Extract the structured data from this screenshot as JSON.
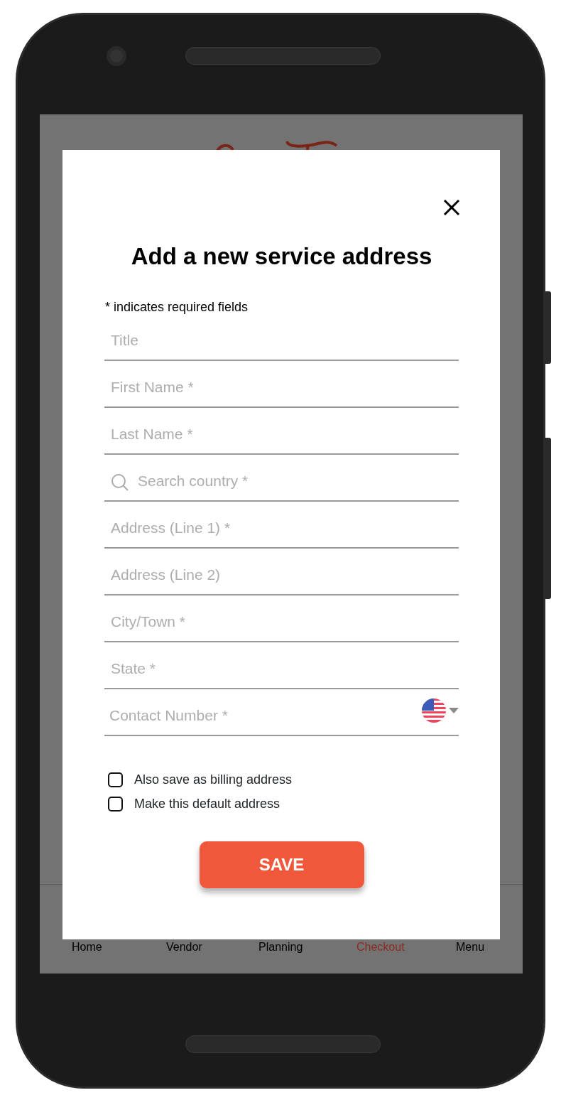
{
  "background_page": {
    "nav": [
      {
        "label": "Home",
        "selected": false
      },
      {
        "label": "Vendor",
        "selected": false
      },
      {
        "label": "Planning",
        "selected": false
      },
      {
        "label": "Checkout",
        "selected": true
      },
      {
        "label": "Menu",
        "selected": false
      }
    ]
  },
  "dialog": {
    "title": "Add a new service address",
    "note": "* indicates required fields",
    "fields": [
      {
        "placeholder": "Title",
        "kind": "text"
      },
      {
        "placeholder": "First Name *",
        "kind": "text"
      },
      {
        "placeholder": "Last Name *",
        "kind": "text"
      },
      {
        "placeholder": "Search country *",
        "kind": "search"
      },
      {
        "placeholder": "Address (Line 1) *",
        "kind": "text"
      },
      {
        "placeholder": "Address (Line 2)",
        "kind": "text"
      },
      {
        "placeholder": "City/Town *",
        "kind": "text"
      },
      {
        "placeholder": "State *",
        "kind": "text"
      },
      {
        "placeholder": "Contact Number *",
        "kind": "phone"
      }
    ],
    "checkboxes": [
      {
        "label": "Also save as billing address",
        "checked": false
      },
      {
        "label": "Make this default address",
        "checked": false
      }
    ],
    "button": "SAVE"
  }
}
